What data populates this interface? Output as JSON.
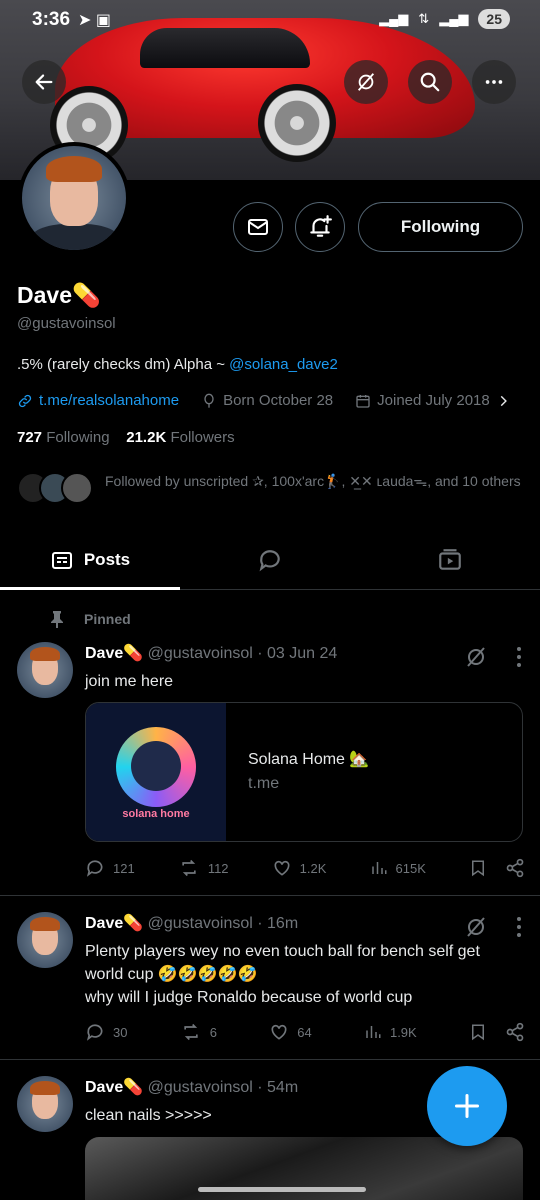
{
  "status_bar": {
    "time": "3:36",
    "battery": "25"
  },
  "profile": {
    "name": "Dave",
    "name_emoji": "💊",
    "handle": "@gustavoinsol",
    "bio_text": ".5% (rarely checks dm) Alpha ~ ",
    "bio_mention": "@solana_dave2",
    "website": "t.me/realsolanahome",
    "born": "Born October 28",
    "joined": "Joined July 2018",
    "following_count": "727",
    "following_label": "Following",
    "followers_count": "21.2K",
    "followers_label": "Followers",
    "followed_by": "Followed by unscripted ✰, 100x'arc🏌, ✕̲✕ ʟaudaᯓ, and 10 others",
    "follow_button": "Following"
  },
  "tabs": [
    {
      "label": "Posts",
      "icon": "posts-icon",
      "active": true
    },
    {
      "label": "",
      "icon": "replies-icon",
      "active": false
    },
    {
      "label": "",
      "icon": "media-icon",
      "active": false
    }
  ],
  "posts": [
    {
      "pinned_label": "Pinned",
      "author": "Dave💊",
      "handle": "@gustavoinsol",
      "time": "03 Jun 24",
      "text": "join me here",
      "card": {
        "logo_text": "solana home",
        "title": "Solana Home 🏡",
        "domain": "t.me"
      },
      "replies": "121",
      "reposts": "112",
      "likes": "1.2K",
      "views": "615K"
    },
    {
      "author": "Dave💊",
      "handle": "@gustavoinsol",
      "time": "16m",
      "text_line1": "Plenty players wey no even touch ball for bench self get world cup 🤣🤣🤣🤣🤣",
      "text_line2": "why will I judge Ronaldo because of world cup",
      "replies": "30",
      "reposts": "6",
      "likes": "64",
      "views": "1.9K"
    },
    {
      "author": "Dave💊",
      "handle": "@gustavoinsol",
      "time": "54m",
      "text": "clean nails >>>>>"
    }
  ],
  "colors": {
    "accent": "#1d9bf0",
    "muted": "#71767b",
    "border": "#2f3336"
  }
}
